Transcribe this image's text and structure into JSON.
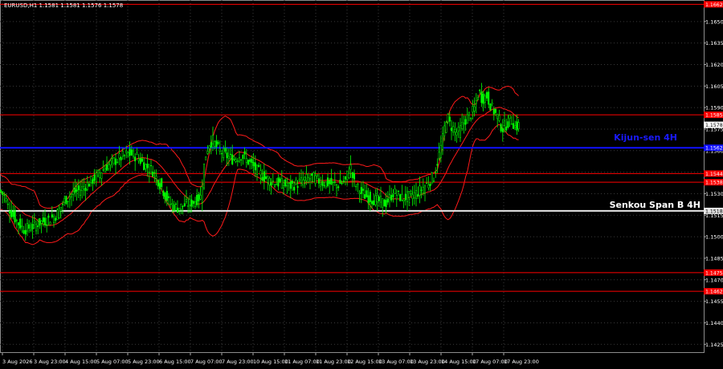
{
  "header": {
    "symbol_text": "EURUSD,H1  1.1581 1.1581 1.1576 1.1578"
  },
  "colors": {
    "background": "#000000",
    "grid": "#3a3a3a",
    "candle": "#00ff00",
    "band": "#ff1a1a",
    "level_red": "#ff0000",
    "level_blue": "#1010ff",
    "level_white": "#e6e6e6",
    "axis_text": "#ffffff",
    "price_tag_text": "#ffffff",
    "current_price_bg": "#ffffff",
    "current_price_text": "#000000"
  },
  "chart_data": {
    "type": "candlestick",
    "symbol": "EURUSD",
    "timeframe": "H1",
    "ylim": [
      1.1419,
      1.1665
    ],
    "y_ticks": [
      1.1425,
      1.144,
      1.1455,
      1.147,
      1.1485,
      1.15,
      1.1515,
      1.153,
      1.1545,
      1.156,
      1.1575,
      1.159,
      1.1605,
      1.162,
      1.1635,
      1.165
    ],
    "x_labels": [
      "3 Aug 2026",
      "3 Aug 23:00",
      "4 Aug 15:00",
      "5 Aug 07:00",
      "5 Aug 23:00",
      "6 Aug 15:00",
      "7 Aug 07:00",
      "7 Aug 23:00",
      "10 Aug 15:00",
      "11 Aug 07:00",
      "11 Aug 23:00",
      "12 Aug 15:00",
      "13 Aug 07:00",
      "13 Aug 23:00",
      "14 Aug 15:00",
      "17 Aug 07:00",
      "17 Aug 23:00"
    ],
    "current_price": 1.1578,
    "levels": [
      {
        "price": 1.1662,
        "label": "1.1662",
        "kind": "red"
      },
      {
        "price": 1.1585,
        "label": "1.1585",
        "kind": "red"
      },
      {
        "price": 1.1562,
        "label": "1.1562",
        "kind": "blue",
        "name": "Kijun-sen 4H"
      },
      {
        "price": 1.1544,
        "label": "1.1544",
        "kind": "red"
      },
      {
        "price": 1.1538,
        "label": "1.1538",
        "kind": "red"
      },
      {
        "price": 1.1518,
        "label": "1.1518",
        "kind": "white",
        "name": "Senkou Span B 4H"
      },
      {
        "price": 1.1475,
        "label": "1.1475",
        "kind": "red"
      },
      {
        "price": 1.1462,
        "label": "1.1462",
        "kind": "red"
      }
    ],
    "close_path": [
      [
        0,
        1.1532
      ],
      [
        6,
        1.1528
      ],
      [
        10,
        1.1521
      ],
      [
        16,
        1.1515
      ],
      [
        22,
        1.151
      ],
      [
        30,
        1.1505
      ],
      [
        40,
        1.1507
      ],
      [
        50,
        1.151
      ],
      [
        60,
        1.1512
      ],
      [
        70,
        1.1515
      ],
      [
        80,
        1.1525
      ],
      [
        90,
        1.153
      ],
      [
        100,
        1.1533
      ],
      [
        110,
        1.1537
      ],
      [
        120,
        1.1542
      ],
      [
        130,
        1.1548
      ],
      [
        140,
        1.1552
      ],
      [
        150,
        1.1555
      ],
      [
        160,
        1.1558
      ],
      [
        170,
        1.1556
      ],
      [
        180,
        1.155
      ],
      [
        190,
        1.1546
      ],
      [
        200,
        1.1536
      ],
      [
        210,
        1.1524
      ],
      [
        220,
        1.152
      ],
      [
        230,
        1.1522
      ],
      [
        240,
        1.1524
      ],
      [
        250,
        1.1528
      ],
      [
        255,
        1.1555
      ],
      [
        260,
        1.1565
      ],
      [
        265,
        1.1567
      ],
      [
        270,
        1.1562
      ],
      [
        280,
        1.1557
      ],
      [
        290,
        1.1554
      ],
      [
        300,
        1.1557
      ],
      [
        310,
        1.1552
      ],
      [
        320,
        1.1546
      ],
      [
        330,
        1.1541
      ],
      [
        340,
        1.1538
      ],
      [
        350,
        1.1537
      ],
      [
        360,
        1.1535
      ],
      [
        370,
        1.1537
      ],
      [
        380,
        1.154
      ],
      [
        390,
        1.1541
      ],
      [
        400,
        1.1538
      ],
      [
        410,
        1.1537
      ],
      [
        420,
        1.1536
      ],
      [
        430,
        1.1539
      ],
      [
        436,
        1.155
      ],
      [
        440,
        1.1538
      ],
      [
        450,
        1.153
      ],
      [
        460,
        1.1527
      ],
      [
        470,
        1.1525
      ],
      [
        480,
        1.1523
      ],
      [
        490,
        1.1531
      ],
      [
        500,
        1.1527
      ],
      [
        510,
        1.1528
      ],
      [
        520,
        1.1531
      ],
      [
        530,
        1.1536
      ],
      [
        540,
        1.1542
      ],
      [
        550,
        1.1565
      ],
      [
        556,
        1.1585
      ],
      [
        560,
        1.1578
      ],
      [
        570,
        1.1572
      ],
      [
        580,
        1.1582
      ],
      [
        590,
        1.1588
      ],
      [
        596,
        1.1602
      ],
      [
        600,
        1.1596
      ],
      [
        606,
        1.1598
      ],
      [
        612,
        1.159
      ],
      [
        620,
        1.1583
      ],
      [
        625,
        1.1575
      ],
      [
        630,
        1.1578
      ],
      [
        636,
        1.1582
      ],
      [
        642,
        1.1576
      ],
      [
        646,
        1.1578
      ]
    ]
  },
  "annotations": {
    "kijun_label": "Kijun-sen 4H",
    "senkou_label": "Senkou Span B 4H"
  }
}
